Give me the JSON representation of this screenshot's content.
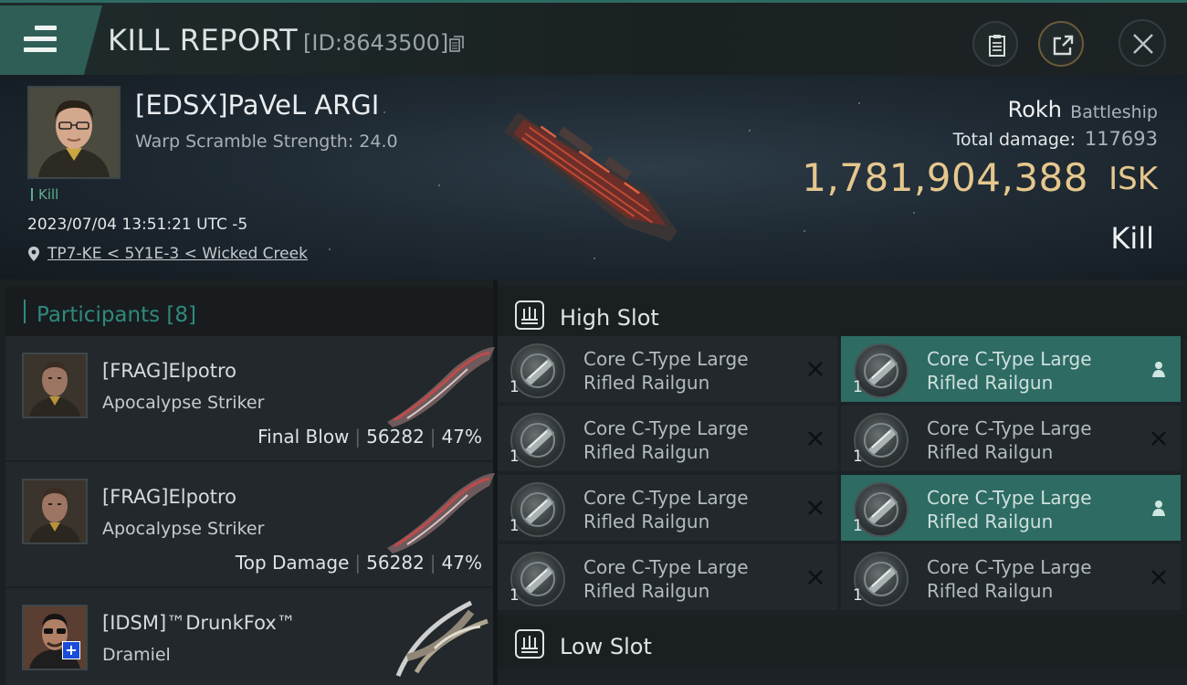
{
  "header": {
    "title": "KILL REPORT",
    "report_id": "[ID:8643500]",
    "icons": [
      "menu-icon",
      "copy-icon",
      "clipboard-icon",
      "share-icon",
      "close-icon"
    ],
    "accent_color": "#2f5e57"
  },
  "victim": {
    "name": "[EDSX]PaVeL ARGI",
    "warp_scramble": "Warp Scramble Strength: 24.0",
    "kill_tag": "Kill",
    "datetime": "2023/07/04 13:51:21 UTC -5",
    "location": "TP7-KE < 5Y1E-3 < Wicked Creek",
    "ship_name": "Rokh",
    "ship_class": "Battleship",
    "total_damage_label": "Total damage:",
    "total_damage": "117693",
    "isk_value": "1,781,904,388",
    "isk_unit": "ISK",
    "result": "Kill",
    "isk_color": "#e6c78d"
  },
  "participants": {
    "header": "Participants [8]",
    "list": [
      {
        "name": "[FRAG]Elpotro",
        "ship": "Apocalypse Striker",
        "role": "Final Blow",
        "damage": "56282",
        "percent": "47%"
      },
      {
        "name": "[FRAG]Elpotro",
        "ship": "Apocalypse Striker",
        "role": "Top Damage",
        "damage": "56282",
        "percent": "47%"
      },
      {
        "name": "[IDSM]™DrunkFox™",
        "ship": "Dramiel",
        "role": "",
        "damage": "",
        "percent": "",
        "badge": "+"
      }
    ]
  },
  "slots": {
    "high": {
      "label": "High Slot",
      "modules": [
        {
          "line1": "Core C-Type Large",
          "line2": "Rifled Railgun",
          "qty": "1",
          "state": "destroyed"
        },
        {
          "line1": "Core C-Type Large",
          "line2": "Rifled Railgun",
          "qty": "1",
          "state": "dropped"
        },
        {
          "line1": "Core C-Type Large",
          "line2": "Rifled Railgun",
          "qty": "1",
          "state": "destroyed"
        },
        {
          "line1": "Core C-Type Large",
          "line2": "Rifled Railgun",
          "qty": "1",
          "state": "destroyed"
        },
        {
          "line1": "Core C-Type Large",
          "line2": "Rifled Railgun",
          "qty": "1",
          "state": "destroyed"
        },
        {
          "line1": "Core C-Type Large",
          "line2": "Rifled Railgun",
          "qty": "1",
          "state": "dropped"
        },
        {
          "line1": "Core C-Type Large",
          "line2": "Rifled Railgun",
          "qty": "1",
          "state": "destroyed"
        },
        {
          "line1": "Core C-Type Large",
          "line2": "Rifled Railgun",
          "qty": "1",
          "state": "destroyed"
        }
      ]
    },
    "low": {
      "label": "Low Slot"
    }
  }
}
